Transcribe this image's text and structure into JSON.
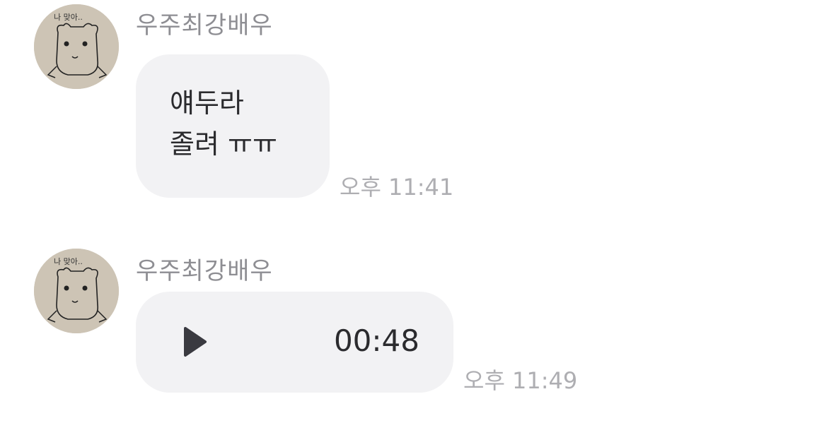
{
  "messages": [
    {
      "sender": "우주최강배우",
      "text": "얘두라\n졸려 ㅠㅠ",
      "time": "오후 11:41",
      "avatar_icon": "bear-drawing-avatar",
      "avatar_caption": "나 맞아.."
    },
    {
      "sender": "우주최강배우",
      "type": "voice",
      "duration": "00:48",
      "time": "오후 11:49",
      "avatar_icon": "bear-drawing-avatar",
      "avatar_caption": "나 맞아.."
    }
  ],
  "colors": {
    "bubble": "#f2f2f4",
    "sender": "#8e8e93",
    "time": "#aeaeb2",
    "text": "#2b2b2e"
  }
}
